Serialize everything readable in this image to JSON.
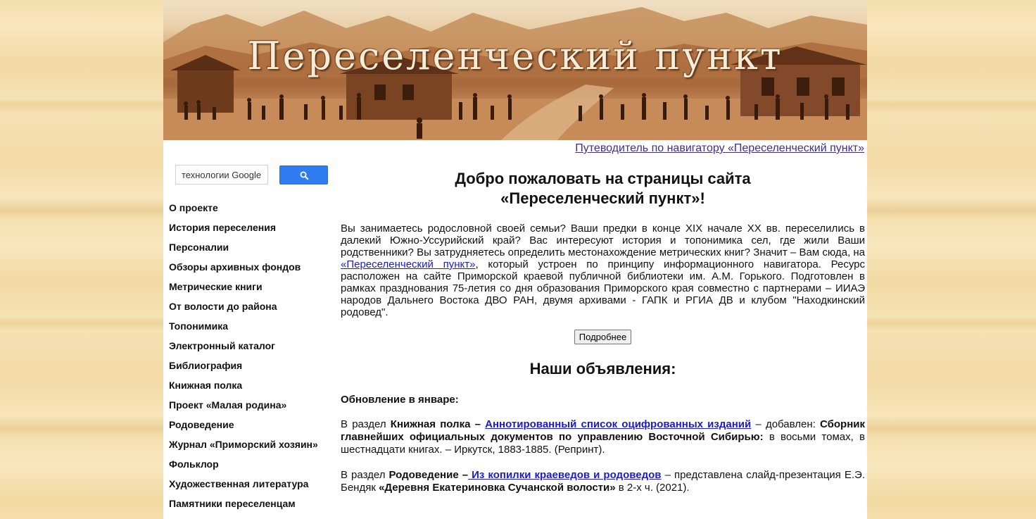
{
  "banner": {
    "title": "Переселенческий пункт"
  },
  "guide_link": "Путеводитель по навигатору «Переселенческий пункт»",
  "search": {
    "value": "технологии Google"
  },
  "nav": [
    "О проекте",
    "История переселения",
    "Персоналии",
    "Обзоры архивных фондов",
    "Метрические книги",
    "От волости до района",
    "Топонимика",
    "Электронный каталог",
    "Библиография",
    "Книжная полка",
    "Проект «Малая родина»",
    "Родоведение",
    "Журнал «Приморский хозяин»",
    "Фольклор",
    "Художественная литература",
    "Памятники переселенцам"
  ],
  "welcome": {
    "line1": "Добро пожаловать на страницы сайта",
    "line2": "«Переселенческий пункт»!"
  },
  "intro": {
    "before": "Вы занимаетесь родословной своей семьи? Ваши предки в конце XIX начале XX вв. переселились в далекий Южно-Уссурийский край? Вас интересуют история и топонимика сел, где жили Ваши родственники? Вы затрудняетесь определить местонахождение метрических книг? Значит – Вам сюда, на ",
    "link": "«Переселенческий пункт»",
    "after": ", который устроен по принципу информационного навигатора. Ресурс расположен на сайте Приморской краевой публичной библиотеки им. А.М. Горького. Подготовлен в рамках празднования 75-летия со дня образования Приморского края совместно с партнерами – ИИАЭ народов Дальнего Востока ДВО РАН, двумя архивами - ГАПК и РГИА ДВ и клубом \"Находкинский родовед\"."
  },
  "more_button": "Подробнее",
  "ads_title": "Наши объявления:",
  "update_head": "Обновление в январе:",
  "news": [
    {
      "p1": "В раздел ",
      "b1": "Книжная полка – ",
      "link": "Аннотированный список оцифрованных изданий",
      "p2": " – добавлен: ",
      "b2": "Сборник главнейших официальных документов по управлению Восточной Сибирью:",
      "p3": " в восьми томах, в шестнадцати книгах. – Иркутск, 1883-1885. (Репринт)."
    },
    {
      "p1": "В раздел ",
      "b1": "Родоведение –",
      "link": " Из копилки краеведов и родоведов",
      "p2": " – представлена слайд-презентация Е.Э. Бендяк ",
      "b2": "«Деревня Екатериновка Сучанской волости»",
      "p3": " в 2-х ч. (2021)."
    }
  ]
}
